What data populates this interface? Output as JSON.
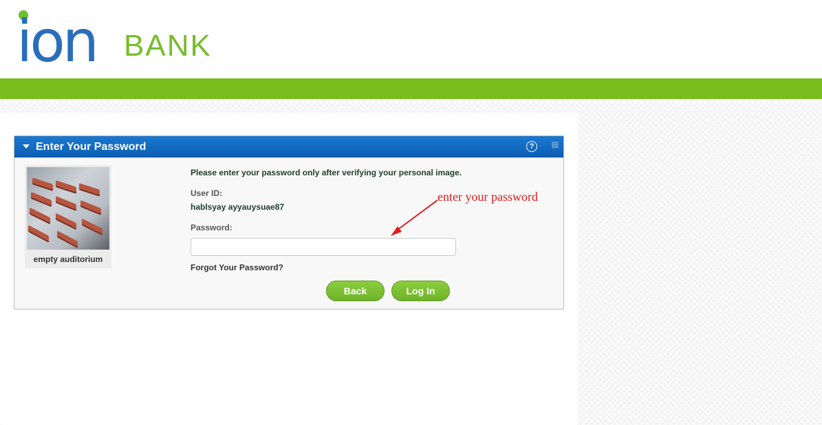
{
  "brand": {
    "logo_primary": "ion",
    "logo_secondary": "BANK",
    "colors": {
      "blue": "#2a6ebb",
      "green": "#79bd1d",
      "panel_header": "#0b5fb5",
      "annotation_red": "#e31a1a"
    }
  },
  "panel": {
    "title": "Enter Your Password",
    "help_glyph": "?",
    "intro_text": "Please enter your password only after verifying your personal image.",
    "user_id_label": "User ID:",
    "user_id_value": "hablsyay ayyauysuae87",
    "password_label": "Password:",
    "password_value": "",
    "forgot_link": "Forgot Your Password?",
    "personal_image": {
      "caption": "empty auditorium"
    },
    "buttons": {
      "back": "Back",
      "login": "Log In"
    }
  },
  "annotation": {
    "text": "enter your password"
  },
  "icons": [
    "collapse-caret-icon",
    "help-icon",
    "resize-grip-icon"
  ]
}
